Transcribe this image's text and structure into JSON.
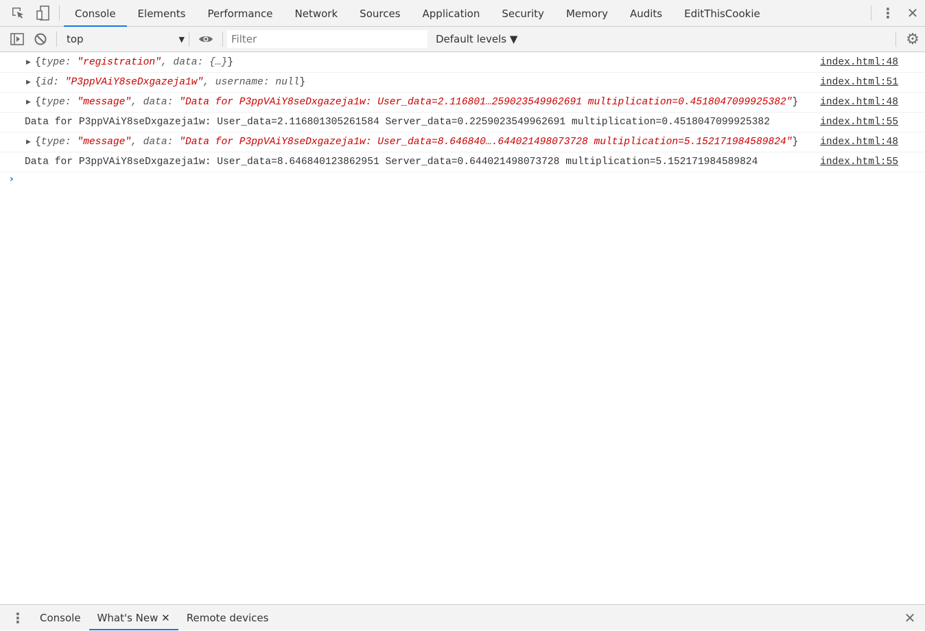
{
  "tabs": [
    "Console",
    "Elements",
    "Performance",
    "Network",
    "Sources",
    "Application",
    "Security",
    "Memory",
    "Audits",
    "EditThisCookie"
  ],
  "active_tab": "Console",
  "toolbar": {
    "context": "top",
    "filter_placeholder": "Filter",
    "levels": "Default levels ▼"
  },
  "rows": [
    {
      "kind": "object",
      "segments": [
        [
          "p",
          "{"
        ],
        [
          "k",
          "type: "
        ],
        [
          "s",
          "\"registration\""
        ],
        [
          "k",
          ", data: {…}"
        ],
        [
          "p",
          "}"
        ]
      ],
      "source": "index.html:48"
    },
    {
      "kind": "object",
      "segments": [
        [
          "p",
          "{"
        ],
        [
          "k",
          "id: "
        ],
        [
          "s",
          "\"P3ppVAiY8seDxgazeja1w\""
        ],
        [
          "k",
          ", username: null"
        ],
        [
          "p",
          "}"
        ]
      ],
      "source": "index.html:51"
    },
    {
      "kind": "object",
      "segments": [
        [
          "p",
          "{"
        ],
        [
          "k",
          "type: "
        ],
        [
          "s",
          "\"message\""
        ],
        [
          "k",
          ", data: "
        ],
        [
          "s",
          "\"Data for P3ppVAiY8seDxgazeja1w: User_data=2.116801…259023549962691 multiplication=0.4518047099925382\""
        ],
        [
          "p",
          "}"
        ]
      ],
      "source": "index.html:48"
    },
    {
      "kind": "text",
      "text": "Data for P3ppVAiY8seDxgazeja1w: User_data=2.116801305261584 Server_data=0.2259023549962691 multiplication=0.4518047099925382",
      "source": "index.html:55"
    },
    {
      "kind": "object",
      "segments": [
        [
          "p",
          "{"
        ],
        [
          "k",
          "type: "
        ],
        [
          "s",
          "\"message\""
        ],
        [
          "k",
          ", data: "
        ],
        [
          "s",
          "\"Data for P3ppVAiY8seDxgazeja1w: User_data=8.646840….644021498073728 multiplication=5.152171984589824\""
        ],
        [
          "p",
          "}"
        ]
      ],
      "source": "index.html:48"
    },
    {
      "kind": "text",
      "text": "Data for P3ppVAiY8seDxgazeja1w: User_data=8.646840123862951 Server_data=0.644021498073728 multiplication=5.152171984589824",
      "source": "index.html:55"
    }
  ],
  "drawer": {
    "tabs": [
      "Console",
      "What's New",
      "Remote devices"
    ],
    "active": "What's New",
    "close_glyph": "✕"
  },
  "colors": {
    "accent": "#1a73e8",
    "string": "#c80000"
  }
}
